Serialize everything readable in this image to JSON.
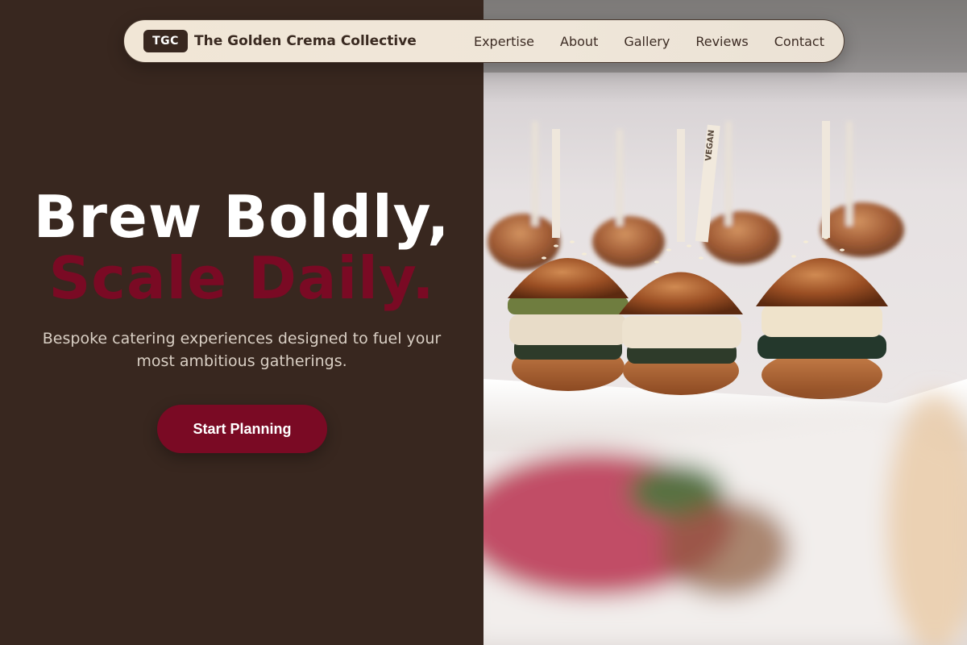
{
  "nav": {
    "logo_text": "TGC",
    "brand": "The Golden Crema Collective",
    "links": [
      "Expertise",
      "About",
      "Gallery",
      "Reviews",
      "Contact"
    ]
  },
  "hero": {
    "headline_line1": "Brew Boldly,",
    "headline_line2": "Scale Daily.",
    "subtitle": "Bespoke catering experiences designed to fuel your most ambitious gatherings.",
    "cta_label": "Start Planning"
  },
  "image": {
    "description_icon": "slider-burgers-photo",
    "pick_label": "VEGAN"
  },
  "colors": {
    "background": "#38271f",
    "accent": "#7a0a24",
    "navbar": "#f1e6d6",
    "text_light": "#ffffff"
  }
}
